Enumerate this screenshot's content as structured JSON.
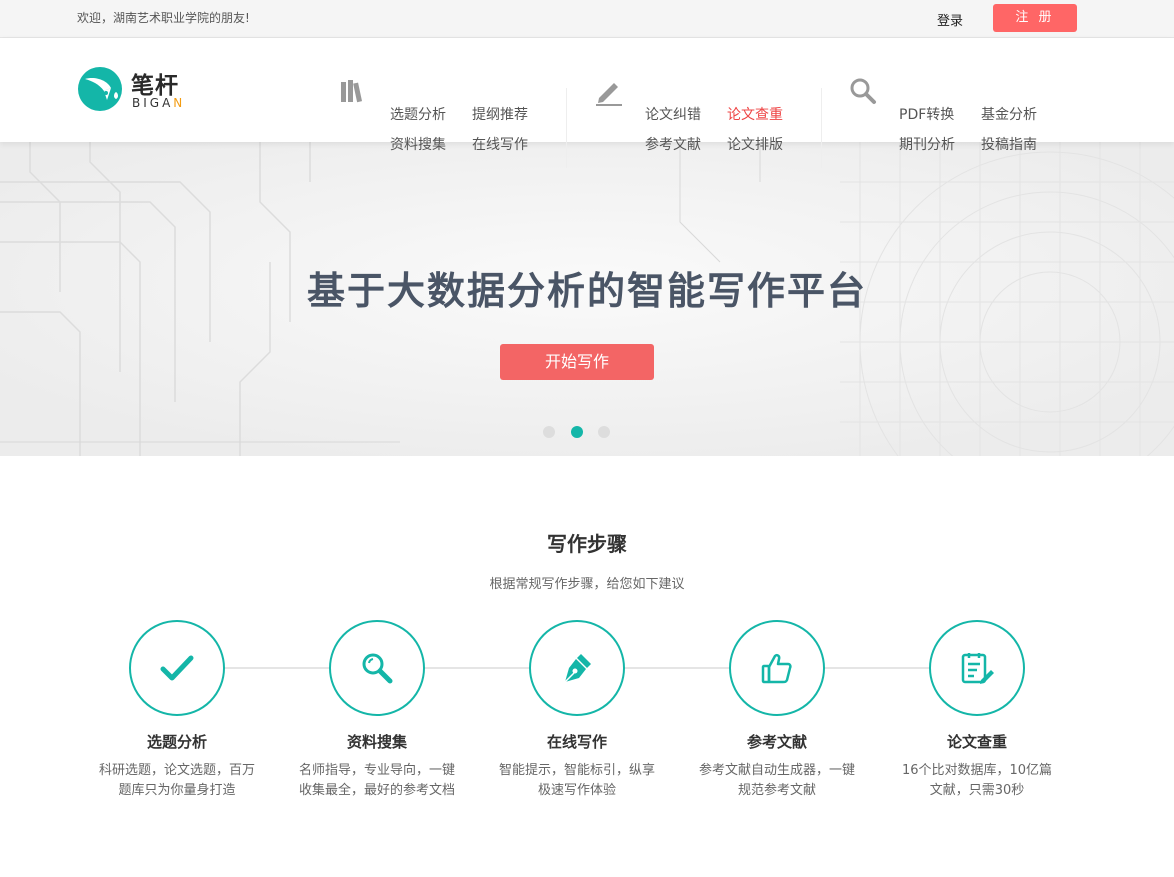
{
  "topbar": {
    "welcome": "欢迎，湖南艺术职业学院的朋友!",
    "login": "登录",
    "register": "注 册"
  },
  "logo": {
    "cn": "笔杆",
    "en_main": "BIGA",
    "en_accent": "N"
  },
  "nav": {
    "group1": [
      "选题分析",
      "提纲推荐",
      "资料搜集",
      "在线写作"
    ],
    "group2": [
      "论文纠错",
      "论文查重",
      "参考文献",
      "论文排版"
    ],
    "group3": [
      "PDF转换",
      "基金分析",
      "期刊分析",
      "投稿指南"
    ],
    "active": "论文查重"
  },
  "banner": {
    "title": "基于大数据分析的智能写作平台",
    "button": "开始写作",
    "active_dot": 2
  },
  "steps": {
    "title": "写作步骤",
    "subtitle": "根据常规写作步骤，给您如下建议",
    "items": [
      {
        "name": "选题分析",
        "desc": "科研选题，论文选题，百万题库只为你量身打造",
        "icon": "check-icon"
      },
      {
        "name": "资料搜集",
        "desc": "名师指导，专业导向，一键收集最全，最好的参考文档",
        "icon": "search-icon"
      },
      {
        "name": "在线写作",
        "desc": "智能提示，智能标引，纵享极速写作体验",
        "icon": "pen-nib-icon"
      },
      {
        "name": "参考文献",
        "desc": "参考文献自动生成器，一键规范参考文献",
        "icon": "thumbs-up-icon"
      },
      {
        "name": "论文查重",
        "desc": "16个比对数据库，10亿篇文献，只需30秒",
        "icon": "document-edit-icon"
      }
    ]
  },
  "colors": {
    "accent": "#14b6a8",
    "primary_button": "#f36565",
    "active_link": "#e44444"
  }
}
